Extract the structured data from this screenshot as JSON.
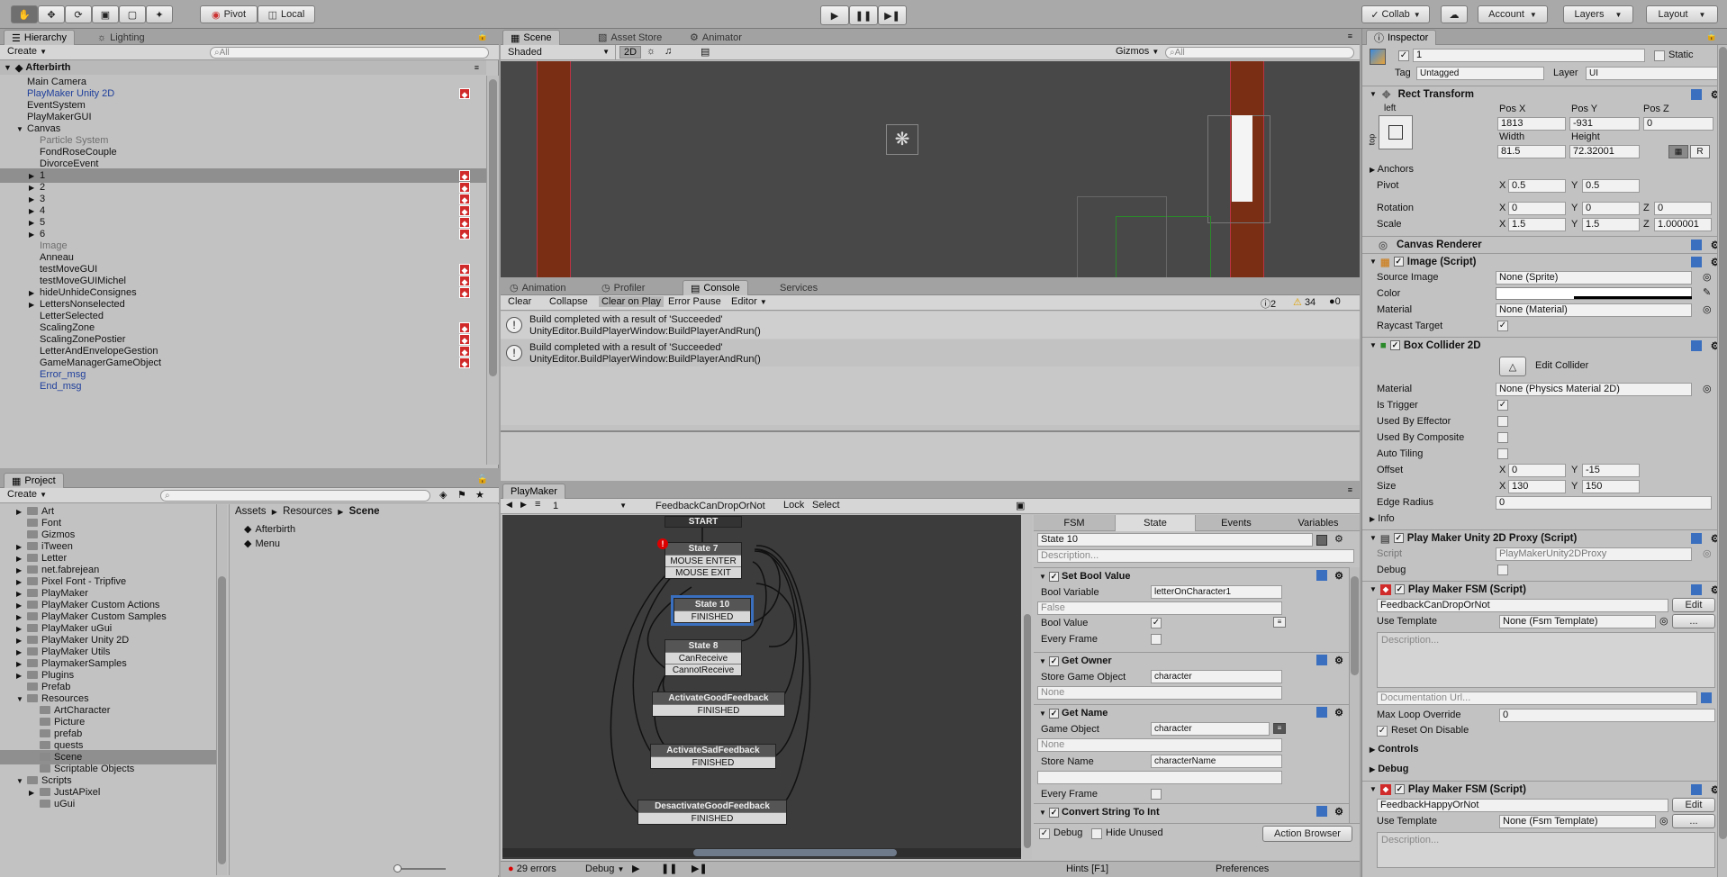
{
  "toolbar": {
    "pivot": "Pivot",
    "local": "Local",
    "collab": "Collab",
    "account": "Account",
    "layers": "Layers",
    "layout": "Layout"
  },
  "hierarchy": {
    "tabs": [
      "Hierarchy",
      "Lighting"
    ],
    "create": "Create",
    "search_placeholder": "All",
    "scene": "Afterbirth",
    "items": [
      {
        "label": "Main Camera",
        "indent": 1
      },
      {
        "label": "PlayMaker Unity 2D",
        "indent": 1,
        "blue": true,
        "pm": true
      },
      {
        "label": "EventSystem",
        "indent": 1
      },
      {
        "label": "PlayMakerGUI",
        "indent": 1
      },
      {
        "label": "Canvas",
        "indent": 1,
        "open": true
      },
      {
        "label": "Particle System",
        "indent": 2,
        "grey": true
      },
      {
        "label": "FondRoseCouple",
        "indent": 2
      },
      {
        "label": "DivorceEvent",
        "indent": 2
      },
      {
        "label": "1",
        "indent": 2,
        "arrow": true,
        "pm": true,
        "selected": true
      },
      {
        "label": "2",
        "indent": 2,
        "arrow": true,
        "pm": true
      },
      {
        "label": "3",
        "indent": 2,
        "arrow": true,
        "pm": true
      },
      {
        "label": "4",
        "indent": 2,
        "arrow": true,
        "pm": true
      },
      {
        "label": "5",
        "indent": 2,
        "arrow": true,
        "pm": true
      },
      {
        "label": "6",
        "indent": 2,
        "arrow": true,
        "pm": true
      },
      {
        "label": "Image",
        "indent": 2,
        "grey": true
      },
      {
        "label": "Anneau",
        "indent": 2
      },
      {
        "label": "testMoveGUI",
        "indent": 2,
        "pm": true
      },
      {
        "label": "testMoveGUIMichel",
        "indent": 2,
        "pm": true
      },
      {
        "label": "hideUnhideConsignes",
        "indent": 2,
        "arrow": true,
        "pm": true
      },
      {
        "label": "LettersNonselected",
        "indent": 2,
        "arrow": true
      },
      {
        "label": "LetterSelected",
        "indent": 2
      },
      {
        "label": "ScalingZone",
        "indent": 2,
        "pm": true
      },
      {
        "label": "ScalingZonePostier",
        "indent": 2,
        "pm": true
      },
      {
        "label": "LetterAndEnvelopeGestion",
        "indent": 2,
        "pm": true
      },
      {
        "label": "GameManagerGameObject",
        "indent": 2,
        "pm": true
      },
      {
        "label": "Error_msg",
        "indent": 2,
        "blue": true
      },
      {
        "label": "End_msg",
        "indent": 2,
        "blue": true
      }
    ]
  },
  "project": {
    "tab": "Project",
    "create": "Create",
    "folders": [
      {
        "label": "Art",
        "indent": 1,
        "arrow": true
      },
      {
        "label": "Font",
        "indent": 1
      },
      {
        "label": "Gizmos",
        "indent": 1
      },
      {
        "label": "iTween",
        "indent": 1,
        "arrow": true
      },
      {
        "label": "Letter",
        "indent": 1,
        "arrow": true
      },
      {
        "label": "net.fabrejean",
        "indent": 1,
        "arrow": true
      },
      {
        "label": "Pixel Font - Tripfive",
        "indent": 1,
        "arrow": true
      },
      {
        "label": "PlayMaker",
        "indent": 1,
        "arrow": true
      },
      {
        "label": "PlayMaker Custom Actions",
        "indent": 1,
        "arrow": true
      },
      {
        "label": "PlayMaker Custom Samples",
        "indent": 1,
        "arrow": true
      },
      {
        "label": "PlayMaker uGui",
        "indent": 1,
        "arrow": true
      },
      {
        "label": "PlayMaker Unity 2D",
        "indent": 1,
        "arrow": true
      },
      {
        "label": "PlayMaker Utils",
        "indent": 1,
        "arrow": true
      },
      {
        "label": "PlaymakerSamples",
        "indent": 1,
        "arrow": true
      },
      {
        "label": "Plugins",
        "indent": 1,
        "arrow": true
      },
      {
        "label": "Prefab",
        "indent": 1
      },
      {
        "label": "Resources",
        "indent": 1,
        "open": true
      },
      {
        "label": "ArtCharacter",
        "indent": 2
      },
      {
        "label": "Picture",
        "indent": 2
      },
      {
        "label": "prefab",
        "indent": 2
      },
      {
        "label": "quests",
        "indent": 2
      },
      {
        "label": "Scene",
        "indent": 2,
        "selected": true
      },
      {
        "label": "Scriptable Objects",
        "indent": 2
      },
      {
        "label": "Scripts",
        "indent": 1,
        "open": true
      },
      {
        "label": "JustAPixel",
        "indent": 2,
        "arrow": true
      },
      {
        "label": "uGui",
        "indent": 2
      }
    ],
    "breadcrumb": [
      "Assets",
      "Resources",
      "Scene"
    ],
    "files": [
      "Afterbirth",
      "Menu"
    ]
  },
  "scene": {
    "tabs": [
      "Scene",
      "Asset Store",
      "Animator"
    ],
    "shaded": "Shaded",
    "mode2d": "2D",
    "gizmos": "Gizmos",
    "search_placeholder": "All"
  },
  "console": {
    "tabs": [
      "Animation",
      "Profiler",
      "Console",
      "Services"
    ],
    "buttons": [
      "Clear",
      "Collapse",
      "Clear on Play",
      "Error Pause",
      "Editor"
    ],
    "counts": {
      "info": "2",
      "warn": "34",
      "error": "0"
    },
    "messages": [
      {
        "line1": "Build completed with a result of 'Succeeded'",
        "line2": "UnityEditor.BuildPlayerWindow:BuildPlayerAndRun()"
      },
      {
        "line1": "Build completed with a result of 'Succeeded'",
        "line2": "UnityEditor.BuildPlayerWindow:BuildPlayerAndRun()"
      }
    ]
  },
  "playmaker": {
    "tab": "PlayMaker",
    "object": "1",
    "fsm": "FeedbackCanDropOrNot",
    "lock": "Lock",
    "select": "Select",
    "errors": "29 errors",
    "debug": "Debug",
    "hints": "Hints [F1]",
    "preferences": "Preferences",
    "start": "START",
    "states": [
      {
        "name": "State 7",
        "events": [
          "MOUSE ENTER",
          "MOUSE EXIT"
        ]
      },
      {
        "name": "State 10",
        "events": [
          "FINISHED"
        ]
      },
      {
        "name": "State 8",
        "events": [
          "CanReceive",
          "CannotReceive"
        ]
      },
      {
        "name": "ActivateGoodFeedback",
        "events": [
          "FINISHED"
        ]
      },
      {
        "name": "ActivateSadFeedback",
        "events": [
          "FINISHED"
        ]
      },
      {
        "name": "DesactivateGoodFeedback",
        "events": [
          "FINISHED"
        ]
      }
    ],
    "state_tabs": [
      "FSM",
      "State",
      "Events",
      "Variables"
    ],
    "state_name": "State 10",
    "description_placeholder": "Description...",
    "actions": {
      "set_bool": {
        "title": "Set Bool Value",
        "var_label": "Bool Variable",
        "var_value": "letterOnCharacter1",
        "false_text": "False",
        "value_label": "Bool Value",
        "every_frame": "Every Frame"
      },
      "get_owner": {
        "title": "Get Owner",
        "store_label": "Store Game Object",
        "store_value": "character",
        "none": "None"
      },
      "get_name": {
        "title": "Get Name",
        "go_label": "Game Object",
        "go_value": "character",
        "none": "None",
        "store_label": "Store Name",
        "store_value": "characterName",
        "every_frame": "Every Frame"
      },
      "convert": {
        "title": "Convert String To Int"
      }
    },
    "footer": {
      "debug": "Debug",
      "hide_unused": "Hide Unused",
      "action_browser": "Action Browser"
    }
  },
  "inspector": {
    "tab": "Inspector",
    "name": "1",
    "static": "Static",
    "tag_label": "Tag",
    "tag": "Untagged",
    "layer_label": "Layer",
    "layer": "UI",
    "rect": {
      "title": "Rect Transform",
      "anchor_h": "left",
      "anchor_v": "top",
      "posx_label": "Pos X",
      "posy_label": "Pos Y",
      "posz_label": "Pos Z",
      "posx": "1813",
      "posy": "-931",
      "posz": "0",
      "width_label": "Width",
      "height_label": "Height",
      "width": "81.5",
      "height": "72.32001",
      "r": "R",
      "anchors": "Anchors",
      "pivot_label": "Pivot",
      "pivot_x": "0.5",
      "pivot_y": "0.5",
      "rotation_label": "Rotation",
      "rot_x": "0",
      "rot_y": "0",
      "rot_z": "0",
      "scale_label": "Scale",
      "scale_x": "1.5",
      "scale_y": "1.5",
      "scale_z": "1.000001"
    },
    "canvas_renderer": "Canvas Renderer",
    "image": {
      "title": "Image (Script)",
      "source_label": "Source Image",
      "source": "None (Sprite)",
      "color_label": "Color",
      "material_label": "Material",
      "material": "None (Material)",
      "raycast_label": "Raycast Target"
    },
    "box": {
      "title": "Box Collider 2D",
      "edit": "Edit Collider",
      "material_label": "Material",
      "material": "None (Physics Material 2D)",
      "trigger": "Is Trigger",
      "effector": "Used By Effector",
      "composite": "Used By Composite",
      "auto_tiling": "Auto Tiling",
      "offset_label": "Offset",
      "offset_x": "0",
      "offset_y": "-15",
      "size_label": "Size",
      "size_x": "130",
      "size_y": "150",
      "edge_label": "Edge Radius",
      "edge": "0",
      "info": "Info"
    },
    "proxy": {
      "title": "Play Maker Unity 2D Proxy (Script)",
      "script_label": "Script",
      "script": "PlayMakerUnity2DProxy",
      "debug": "Debug"
    },
    "fsm1": {
      "title": "Play Maker FSM (Script)",
      "name": "FeedbackCanDropOrNot",
      "edit": "Edit",
      "template_label": "Use Template",
      "template": "None (Fsm Template)",
      "more": "...",
      "description": "Description...",
      "doc_url": "Documentation Url...",
      "max_loop_label": "Max Loop Override",
      "max_loop": "0",
      "reset": "Reset On Disable",
      "controls": "Controls",
      "debug": "Debug"
    },
    "fsm2": {
      "title": "Play Maker FSM (Script)",
      "name": "FeedbackHappyOrNot",
      "edit": "Edit",
      "template_label": "Use Template",
      "template": "None (Fsm Template)",
      "more": "...",
      "description": "Description..."
    }
  },
  "colors": {
    "panel": "#c2c2c2",
    "selection": "#8f8f8f",
    "scene_bg": "#484848",
    "orange_bar": "#7a2e14",
    "playmaker_bg": "#3c3c3c",
    "pm_icon": "#d12a2a"
  }
}
